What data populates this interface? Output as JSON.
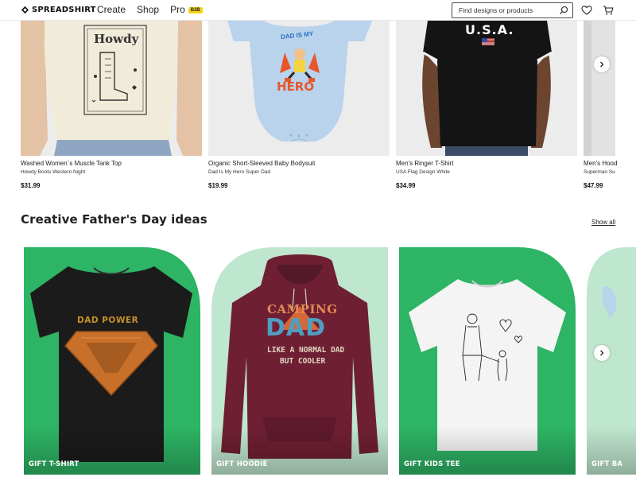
{
  "header": {
    "logo_text": "SPREADSHIRT",
    "nav": [
      "Create",
      "Shop",
      "Pro"
    ],
    "pro_badge": "B2B",
    "search_placeholder": "Find designs or products"
  },
  "products": [
    {
      "name": "Washed Women´s Muscle Tank Top",
      "design": "Howdy Boots Western Night",
      "price": "$31.99",
      "art_text": "Howdy"
    },
    {
      "name": "Organic Short-Sleeved Baby Bodysuit",
      "design": "Dad Is My Hero Super Dad",
      "price": "$19.99",
      "art_text_1": "DAD IS MY",
      "art_text_2": "HERO"
    },
    {
      "name": "Men's Ringer T-Shirt",
      "design": "USA Flag Design White",
      "price": "$34.99",
      "art_text": "U.S.A."
    },
    {
      "name": "Men's Hood",
      "design": "Superman Su",
      "price": "$47.99"
    }
  ],
  "section": {
    "title": "Creative Father's Day ideas",
    "show_all": "Show all"
  },
  "gift_tiles": [
    {
      "label": "GIFT T-SHIRT",
      "art_text": "DAD POWER"
    },
    {
      "label": "GIFT HOODIE",
      "art_text_1": "CAMPING",
      "art_text_2": "DAD",
      "art_text_3": "LIKE A NORMAL DAD",
      "art_text_4": "BUT COOLER"
    },
    {
      "label": "GIFT KIDS TEE"
    },
    {
      "label": "GIFT BA"
    }
  ],
  "colors": {
    "brand_green": "#2db464",
    "light_green": "#bfe6cf",
    "b2b_yellow": "#f5d31c",
    "hoodie_maroon": "#6e1f33"
  }
}
